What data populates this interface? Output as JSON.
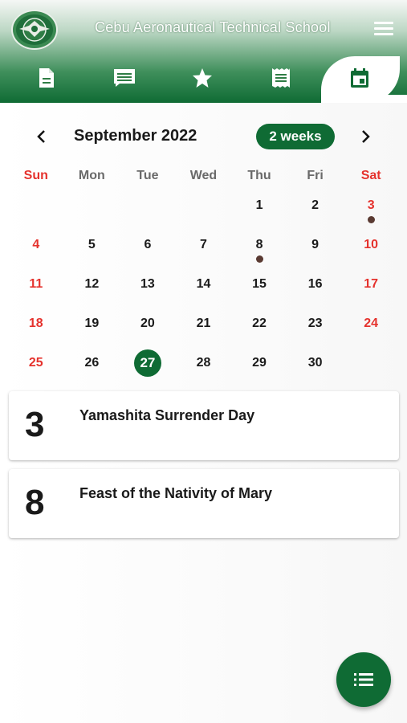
{
  "header": {
    "title": "Cebu Aeronautical Technical School",
    "tabs": [
      {
        "icon": "document-icon",
        "active": false
      },
      {
        "icon": "announcement-icon",
        "active": false
      },
      {
        "icon": "star-icon",
        "active": false
      },
      {
        "icon": "receipt-icon",
        "active": false
      },
      {
        "icon": "calendar-icon",
        "active": true
      }
    ]
  },
  "calendar": {
    "month_title": "September 2022",
    "format_button": "2 weeks",
    "prev_symbol": "‹",
    "next_symbol": "›",
    "weekdays": [
      "Sun",
      "Mon",
      "Tue",
      "Wed",
      "Thu",
      "Fri",
      "Sat"
    ],
    "weeks": [
      [
        "",
        "",
        "",
        "",
        "1",
        "2",
        "3"
      ],
      [
        "4",
        "5",
        "6",
        "7",
        "8",
        "9",
        "10"
      ],
      [
        "11",
        "12",
        "13",
        "14",
        "15",
        "16",
        "17"
      ],
      [
        "18",
        "19",
        "20",
        "21",
        "22",
        "23",
        "24"
      ],
      [
        "25",
        "26",
        "27",
        "28",
        "29",
        "30",
        ""
      ]
    ],
    "selected_day": "27",
    "event_days": [
      "3",
      "8"
    ]
  },
  "events": [
    {
      "day": "3",
      "title": "Yamashita Surrender Day"
    },
    {
      "day": "8",
      "title": "Feast of the Nativity of Mary"
    }
  ],
  "colors": {
    "brand_green": "#0f6b34",
    "weekend_red": "#e5322d",
    "event_marker": "#5a3a32"
  },
  "fab": {
    "icon": "list-icon"
  }
}
